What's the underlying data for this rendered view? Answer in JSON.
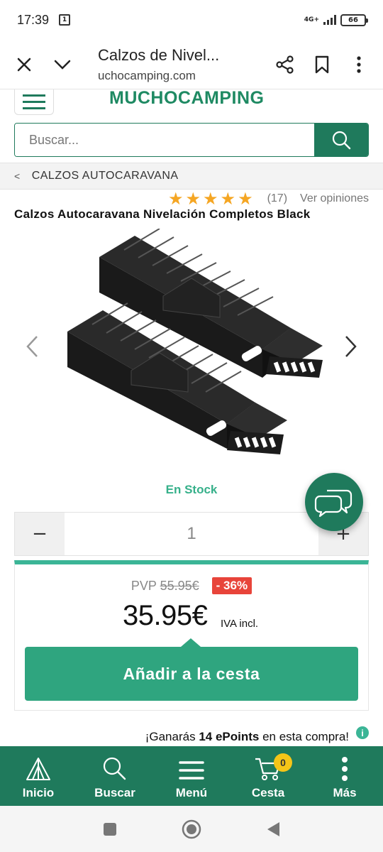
{
  "status_bar": {
    "time": "17:39",
    "notif": "1",
    "network": "4G+",
    "battery": "66"
  },
  "browser": {
    "title": "Calzos de Nivel...",
    "url": "uchocamping.com"
  },
  "site": {
    "logo": "MUCHOCAMPING"
  },
  "search": {
    "placeholder": "Buscar..."
  },
  "breadcrumb": {
    "label": "CALZOS AUTOCARAVANA"
  },
  "rating": {
    "stars": 5,
    "count": "(17)",
    "link": "Ver opiniones"
  },
  "product": {
    "title": "Calzos Autocaravana Nivelación Completos Black",
    "stock": "En Stock"
  },
  "quantity": {
    "minus": "−",
    "value": "1",
    "plus": "+"
  },
  "pricing": {
    "pvp_label": "PVP",
    "pvp_old": "55.95€",
    "discount": "- 36%",
    "price": "35.95€",
    "tax": "IVA incl.",
    "add_button": "Añadir a la cesta"
  },
  "points": {
    "prefix": "¡Ganarás",
    "amount": "14 ePoints",
    "suffix": "en esta compra!",
    "info": "i"
  },
  "bottom_nav": {
    "items": [
      {
        "label": "Inicio",
        "icon": "tent-icon"
      },
      {
        "label": "Buscar",
        "icon": "search-icon"
      },
      {
        "label": "Menú",
        "icon": "menu-icon"
      },
      {
        "label": "Cesta",
        "icon": "cart-icon",
        "badge": "0"
      },
      {
        "label": "Más",
        "icon": "more-icon"
      }
    ]
  },
  "colors": {
    "brand": "#1f7a5c",
    "accent": "#2fa57f",
    "discount": "#e8443a",
    "stars": "#f5a623"
  }
}
